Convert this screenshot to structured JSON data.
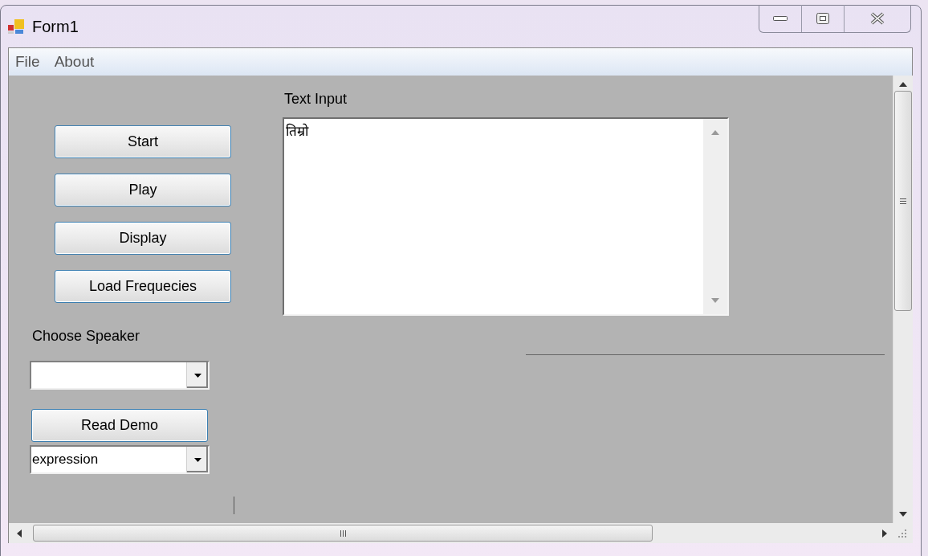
{
  "window": {
    "title": "Form1"
  },
  "menu": [
    {
      "label": "File"
    },
    {
      "label": "About"
    }
  ],
  "buttons": [
    {
      "label": "Start"
    },
    {
      "label": "Play"
    },
    {
      "label": "Display"
    },
    {
      "label": "Load Frequecies"
    }
  ],
  "speaker": {
    "label": "Choose Speaker"
  },
  "read_demo_button": {
    "label": "Read Demo"
  },
  "expression_dropdown": {
    "value": "expression"
  },
  "text_input": {
    "label": "Text Input",
    "value": "तिम्रो"
  }
}
